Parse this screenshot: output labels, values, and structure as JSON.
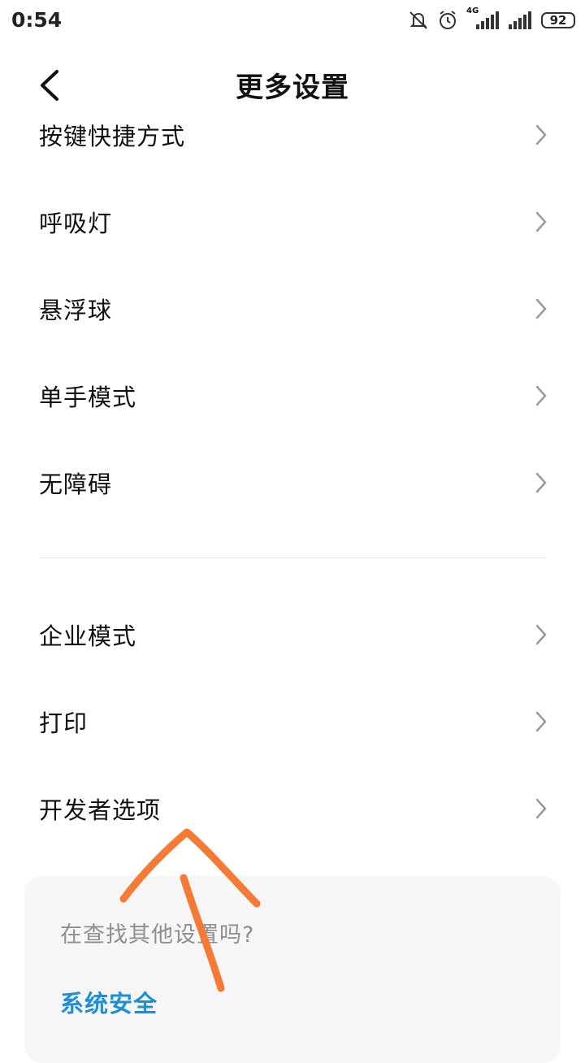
{
  "status": {
    "time": "0:54",
    "network_label": "4G",
    "battery": "92",
    "icons": [
      "mute-icon",
      "alarm-icon",
      "signal-4g-icon",
      "signal-icon",
      "battery-icon"
    ]
  },
  "header": {
    "title": "更多设置",
    "back_icon": "back-arrow-icon"
  },
  "list_group_1": [
    {
      "label": "按键快捷方式"
    },
    {
      "label": "呼吸灯"
    },
    {
      "label": "悬浮球"
    },
    {
      "label": "单手模式"
    },
    {
      "label": "无障碍"
    }
  ],
  "list_group_2": [
    {
      "label": "企业模式"
    },
    {
      "label": "打印"
    },
    {
      "label": "开发者选项"
    }
  ],
  "suggest": {
    "title": "在查找其他设置吗?",
    "link": "系统安全"
  },
  "colors": {
    "link": "#1e8fd6",
    "annotation": "#f47a35",
    "card_bg": "#f6f6f6"
  }
}
